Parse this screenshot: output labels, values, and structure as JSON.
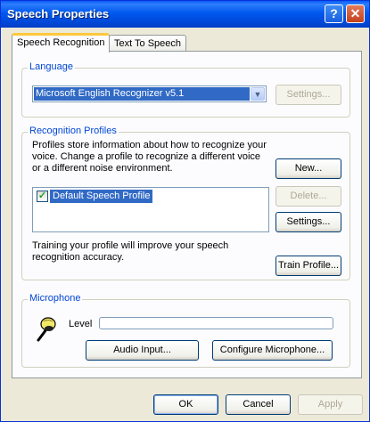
{
  "window": {
    "title": "Speech Properties"
  },
  "titlebar": {
    "help_glyph": "?",
    "close_glyph": "✕"
  },
  "tabs": [
    {
      "label": "Speech Recognition",
      "active": true
    },
    {
      "label": "Text To Speech",
      "active": false
    }
  ],
  "language": {
    "group_label": "Language",
    "selected": "Microsoft English Recognizer v5.1",
    "settings_label": "Settings..."
  },
  "profiles": {
    "group_label": "Recognition Profiles",
    "description": "Profiles store information about how to recognize your voice.  Change a profile to recognize a different voice or a different noise environment.",
    "items": [
      {
        "label": "Default Speech Profile",
        "checked": true
      }
    ],
    "new_label": "New...",
    "delete_label": "Delete...",
    "settings_label": "Settings...",
    "training_text": "Training your profile will improve your speech recognition accuracy.",
    "train_label": "Train Profile..."
  },
  "microphone": {
    "group_label": "Microphone",
    "level_label": "Level",
    "level_value": 0,
    "audio_input_label": "Audio Input...",
    "configure_label": "Configure Microphone..."
  },
  "footer": {
    "ok_label": "OK",
    "cancel_label": "Cancel",
    "apply_label": "Apply"
  },
  "colors": {
    "accent": "#0046d5",
    "selection": "#316ac5",
    "titlebar": "#0058ee"
  }
}
